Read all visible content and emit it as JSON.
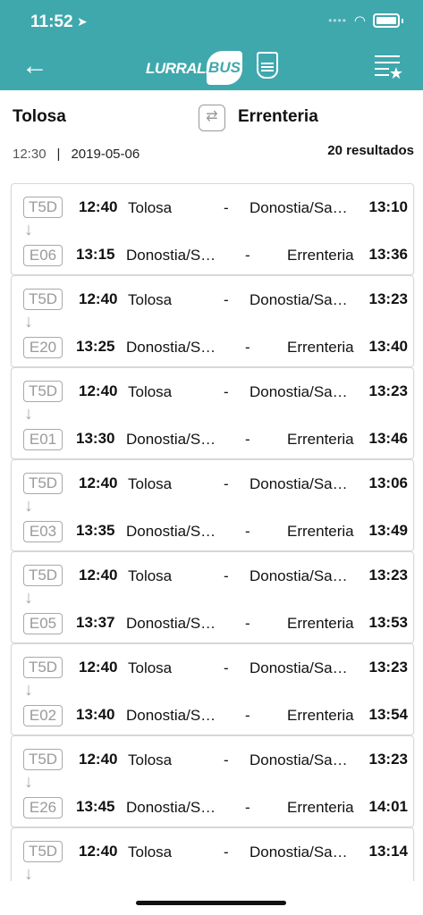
{
  "status": {
    "time": "11:52",
    "location_icon": "location-arrow-icon"
  },
  "header": {
    "logo_text": "LURRALDE",
    "logo_bus": "BUS"
  },
  "route": {
    "origin": "Tolosa",
    "destination": "Errenteria",
    "time": "12:30",
    "separator": "|",
    "date": "2019-05-06",
    "results": "20 resultados"
  },
  "trips": [
    {
      "line1": "T5D",
      "dep1": "12:40",
      "from1": "Tolosa",
      "to1": "Donostia/Sa…",
      "arr1": "13:10",
      "line2": "E06",
      "dep2": "13:15",
      "from2": "Donostia/S…",
      "to2": "Errenteria",
      "arr2": "13:36"
    },
    {
      "line1": "T5D",
      "dep1": "12:40",
      "from1": "Tolosa",
      "to1": "Donostia/Sa…",
      "arr1": "13:23",
      "line2": "E20",
      "dep2": "13:25",
      "from2": "Donostia/S…",
      "to2": "Errenteria",
      "arr2": "13:40"
    },
    {
      "line1": "T5D",
      "dep1": "12:40",
      "from1": "Tolosa",
      "to1": "Donostia/Sa…",
      "arr1": "13:23",
      "line2": "E01",
      "dep2": "13:30",
      "from2": "Donostia/S…",
      "to2": "Errenteria",
      "arr2": "13:46"
    },
    {
      "line1": "T5D",
      "dep1": "12:40",
      "from1": "Tolosa",
      "to1": "Donostia/Sa…",
      "arr1": "13:06",
      "line2": "E03",
      "dep2": "13:35",
      "from2": "Donostia/S…",
      "to2": "Errenteria",
      "arr2": "13:49"
    },
    {
      "line1": "T5D",
      "dep1": "12:40",
      "from1": "Tolosa",
      "to1": "Donostia/Sa…",
      "arr1": "13:23",
      "line2": "E05",
      "dep2": "13:37",
      "from2": "Donostia/S…",
      "to2": "Errenteria",
      "arr2": "13:53"
    },
    {
      "line1": "T5D",
      "dep1": "12:40",
      "from1": "Tolosa",
      "to1": "Donostia/Sa…",
      "arr1": "13:23",
      "line2": "E02",
      "dep2": "13:40",
      "from2": "Donostia/S…",
      "to2": "Errenteria",
      "arr2": "13:54"
    },
    {
      "line1": "T5D",
      "dep1": "12:40",
      "from1": "Tolosa",
      "to1": "Donostia/Sa…",
      "arr1": "13:23",
      "line2": "E26",
      "dep2": "13:45",
      "from2": "Donostia/S…",
      "to2": "Errenteria",
      "arr2": "14:01"
    },
    {
      "line1": "T5D",
      "dep1": "12:40",
      "from1": "Tolosa",
      "to1": "Donostia/Sa…",
      "arr1": "13:14",
      "line2": "",
      "dep2": "",
      "from2": "",
      "to2": "",
      "arr2": ""
    }
  ],
  "colors": {
    "brand": "#3fa8ad",
    "code_border": "#a9a9a9"
  }
}
